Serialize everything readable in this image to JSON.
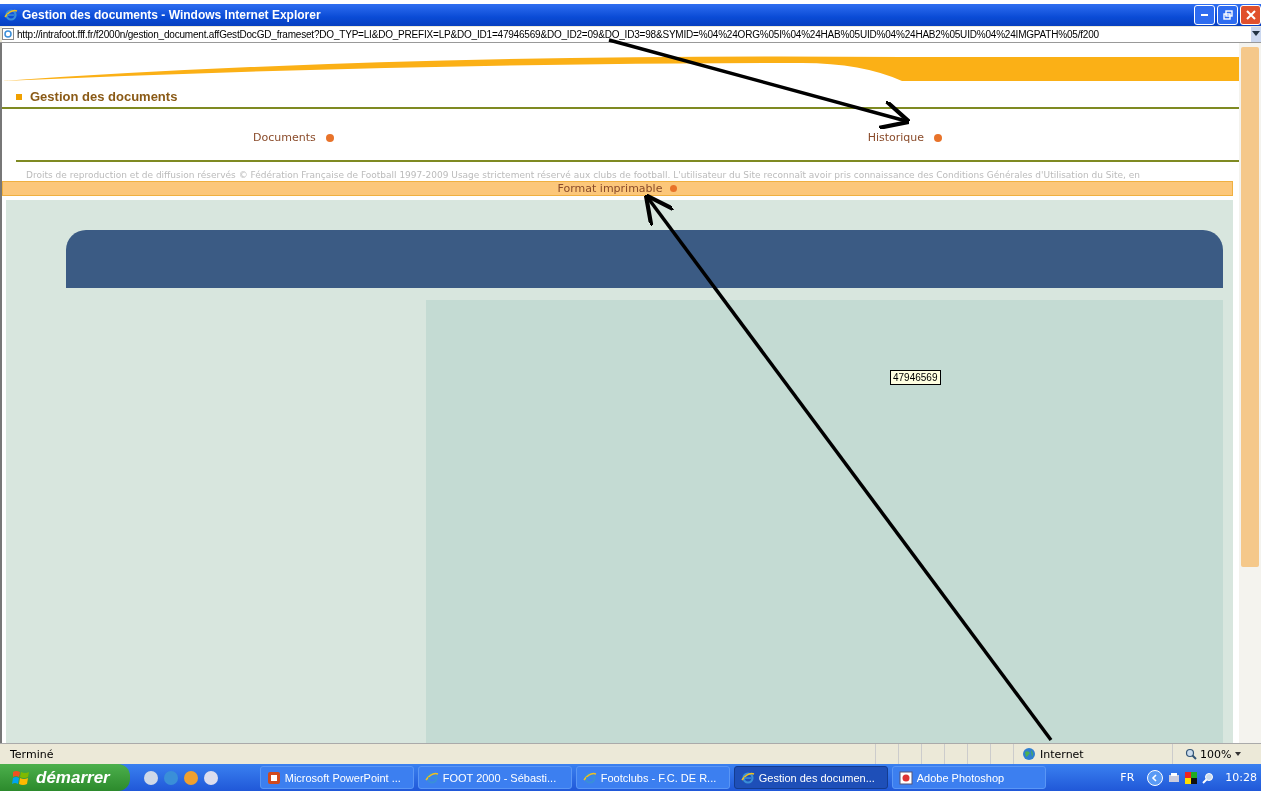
{
  "window": {
    "title": "Gestion des documents - Windows Internet Explorer"
  },
  "address_bar": {
    "value": "http://intrafoot.fff.fr/f2000n/gestion_document.affGestDocGD_frameset?DO_TYP=LI&DO_PREFIX=LP&DO_ID1=47946569&DO_ID2=09&DO_ID3=98&SYMID=%04%24ORG%05I%04%24HAB%05UID%04%24HAB2%05UID%04%24IMGPATH%05/f200"
  },
  "page": {
    "heading": "Gestion des documents",
    "nav": [
      {
        "label": "Documents"
      },
      {
        "label": "Historique"
      }
    ],
    "copyright": "Droits de reproduction et de diffusion réservés © Fédération Française de Football 1997-2009 Usage strictement réservé aux clubs de football. L'utilisateur du Site reconnaît avoir pris connaissance des Conditions Générales d'Utilisation du Site, en",
    "print_link": "Format imprimable",
    "tooltip": "47946569"
  },
  "status_bar": {
    "text": "Terminé",
    "zone": "Internet",
    "zoom": "100%"
  },
  "taskbar": {
    "start": "démarrer",
    "tasks": [
      {
        "label": "Microsoft PowerPoint ...",
        "kind": "ppt",
        "selected": false
      },
      {
        "label": "FOOT 2000 - Sébasti...",
        "kind": "ie",
        "selected": false
      },
      {
        "label": "Footclubs - F.C. DE R...",
        "kind": "ie",
        "selected": false
      },
      {
        "label": "Gestion des documen...",
        "kind": "ie",
        "selected": true
      },
      {
        "label": "Adobe Photoshop",
        "kind": "ps",
        "selected": false
      }
    ],
    "language": "FR",
    "clock": "10:28"
  }
}
